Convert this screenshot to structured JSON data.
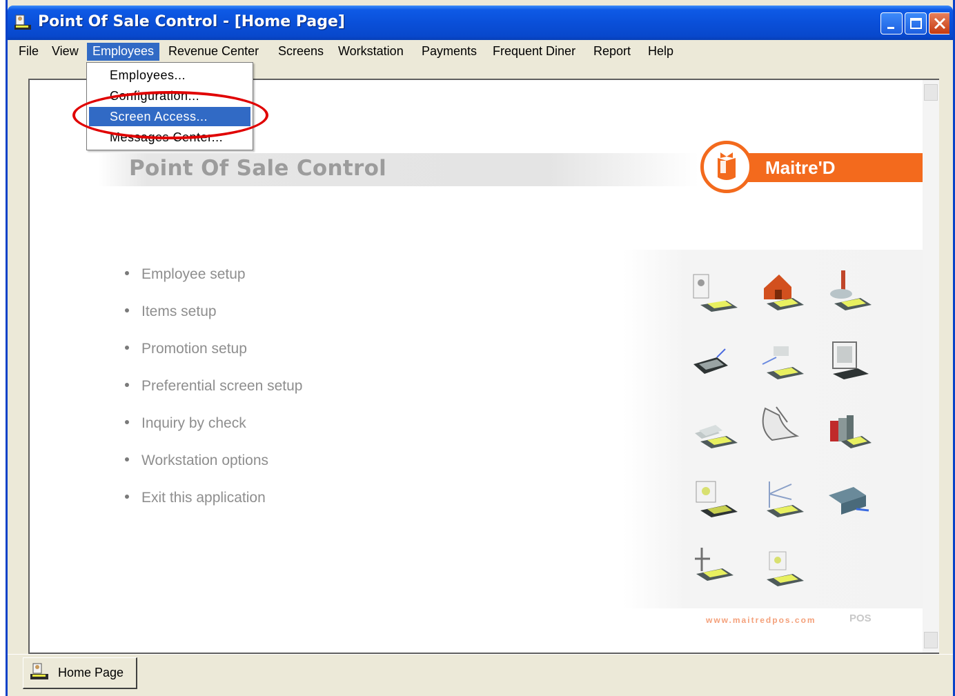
{
  "window": {
    "title": "Point Of Sale Control - [Home Page]",
    "titlebar_color": "#0A4FD8"
  },
  "menubar": {
    "items": [
      "File",
      "View",
      "Employees",
      "Revenue Center",
      "Screens",
      "Workstation",
      "Payments",
      "Frequent Diner",
      "Report",
      "Help"
    ],
    "active": "Employees"
  },
  "dropdown": {
    "items": [
      "Employees...",
      "Configuration...",
      "Screen Access...",
      "Messages Center..."
    ],
    "highlighted": "Screen Access..."
  },
  "page": {
    "banner_title": "Point Of Sale Control",
    "brand_logo": "Maitre'D",
    "brand_color": "#F36A1D",
    "links": [
      "Employee setup",
      "Items setup",
      "Promotion setup",
      "Preferential screen setup",
      "Inquiry by check",
      "Workstation options",
      "Exit this application"
    ],
    "footer_url": "www.maitredpos.com",
    "footer_brand": "POS"
  },
  "tabs": [
    {
      "label": "Home Page",
      "icon": "app-icon"
    }
  ],
  "annotation": {
    "color": "#E00000"
  }
}
